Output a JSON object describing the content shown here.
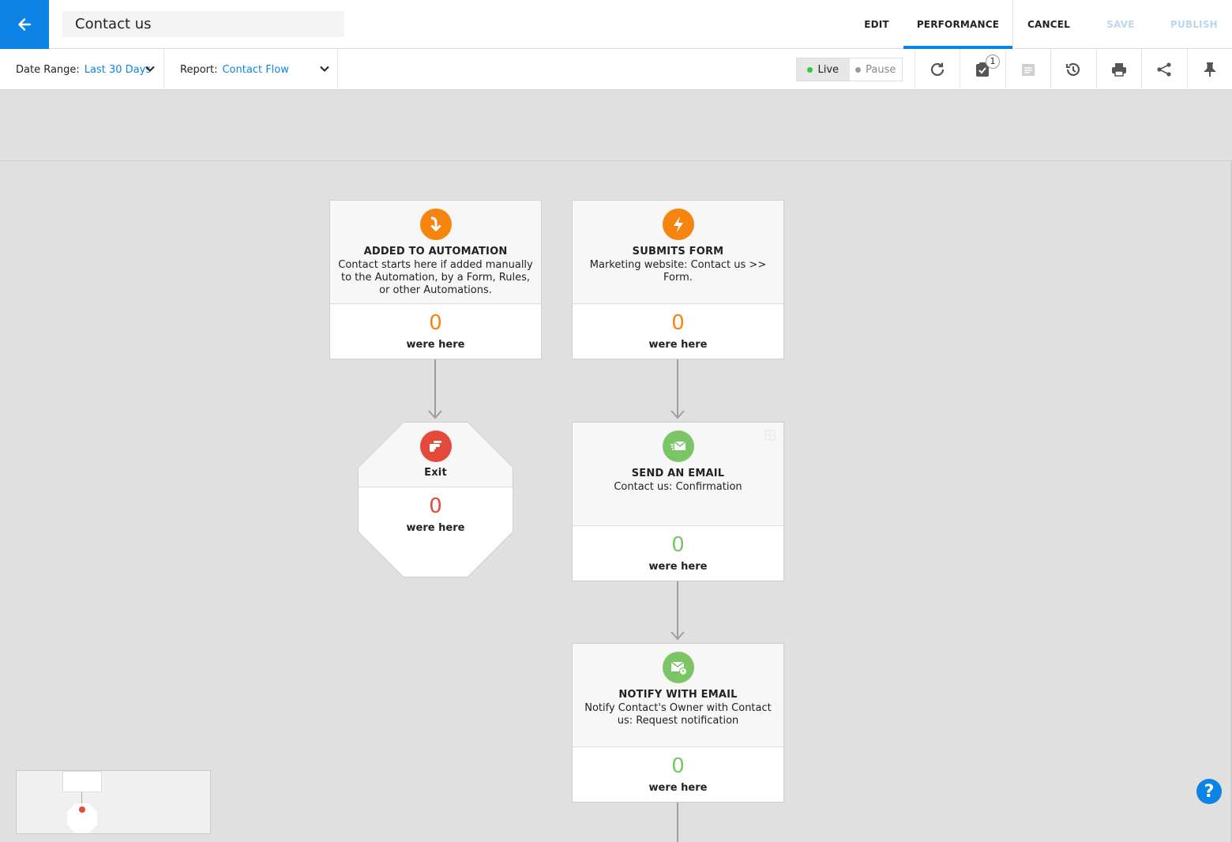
{
  "header": {
    "title": "Contact us",
    "nav": {
      "edit": "EDIT",
      "performance": "PERFORMANCE",
      "cancel": "CANCEL",
      "save": "SAVE",
      "publish": "PUBLISH"
    }
  },
  "toolbar": {
    "date_range_label": "Date Range:",
    "date_range_value": "Last 30 Days",
    "report_label": "Report:",
    "report_value": "Contact Flow",
    "live_label": "Live",
    "pause_label": "Pause",
    "tasks_badge": "1",
    "icons": [
      "refresh-icon",
      "tasks-icon",
      "notes-icon",
      "history-icon",
      "print-icon",
      "share-icon",
      "pin-icon"
    ]
  },
  "nodes": {
    "added": {
      "title": "ADDED TO AUTOMATION",
      "desc": "Contact starts here if added manually to the Automation, by a Form, Rules, or other Automations.",
      "count": "0",
      "label": "were here"
    },
    "submits": {
      "title": "SUBMITS FORM",
      "desc": "Marketing website: Contact us >> Form.",
      "count": "0",
      "label": "were here"
    },
    "exit": {
      "title": "Exit",
      "count": "0",
      "label": "were here"
    },
    "send_email": {
      "title": "SEND AN EMAIL",
      "desc": "Contact us: Confirmation",
      "count": "0",
      "label": "were here"
    },
    "notify": {
      "title": "NOTIFY WITH EMAIL",
      "desc": "Notify Contact's Owner with Contact us: Request notification",
      "count": "0",
      "label": "were here"
    }
  },
  "help_label": "?",
  "colors": {
    "accent": "#0d84e5",
    "orange": "#f5850f",
    "red": "#e24b3b",
    "green": "#7cc566",
    "live_dot": "#2ecc40"
  }
}
